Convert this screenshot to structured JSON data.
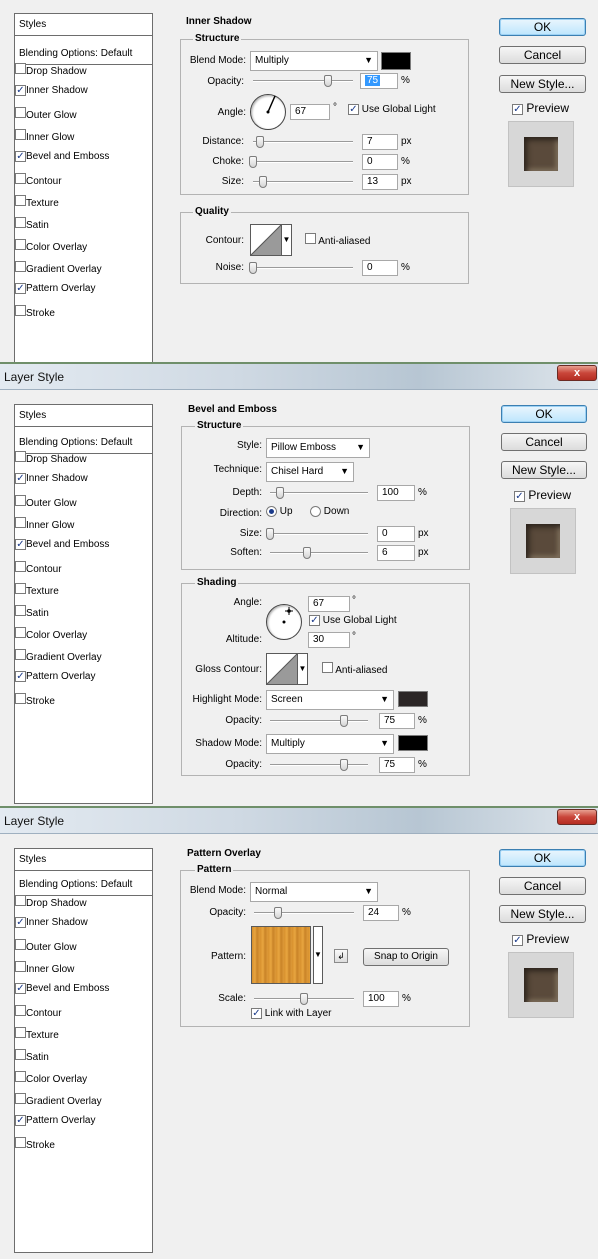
{
  "dialog_title": "Layer Style",
  "close_glyph": "x",
  "buttons": {
    "ok": "OK",
    "cancel": "Cancel",
    "new_style": "New Style...",
    "preview": "Preview"
  },
  "styles_list": {
    "header": "Styles",
    "blending": "Blending Options: Default",
    "items": [
      {
        "label": "Drop Shadow"
      },
      {
        "label": "Inner Shadow"
      },
      {
        "label": "Outer Glow"
      },
      {
        "label": "Inner Glow"
      },
      {
        "label": "Bevel and Emboss"
      },
      {
        "label": "Contour"
      },
      {
        "label": "Texture"
      },
      {
        "label": "Satin"
      },
      {
        "label": "Color Overlay"
      },
      {
        "label": "Gradient Overlay"
      },
      {
        "label": "Pattern Overlay"
      },
      {
        "label": "Stroke"
      }
    ],
    "checked": [
      false,
      true,
      false,
      false,
      true,
      false,
      false,
      false,
      false,
      false,
      true,
      false
    ]
  },
  "inner_shadow": {
    "title": "Inner Shadow",
    "structure": "Structure",
    "blend_mode_label": "Blend Mode:",
    "blend_mode": "Multiply",
    "color": "#000000",
    "opacity_label": "Opacity:",
    "opacity": "75",
    "opacity_unit": "%",
    "angle_label": "Angle:",
    "angle": "67",
    "angle_unit": "°",
    "use_global_light": "Use Global Light",
    "distance_label": "Distance:",
    "distance": "7",
    "distance_unit": "px",
    "choke_label": "Choke:",
    "choke": "0",
    "choke_unit": "%",
    "size_label": "Size:",
    "size": "13",
    "size_unit": "px",
    "quality": "Quality",
    "contour_label": "Contour:",
    "anti_aliased": "Anti-aliased",
    "noise_label": "Noise:",
    "noise": "0",
    "noise_unit": "%"
  },
  "bevel_emboss": {
    "title": "Bevel and Emboss",
    "structure": "Structure",
    "style_label": "Style:",
    "style": "Pillow Emboss",
    "technique_label": "Technique:",
    "technique": "Chisel Hard",
    "depth_label": "Depth:",
    "depth": "100",
    "depth_unit": "%",
    "direction_label": "Direction:",
    "up": "Up",
    "down": "Down",
    "size_label": "Size:",
    "size": "0",
    "size_unit": "px",
    "soften_label": "Soften:",
    "soften": "6",
    "soften_unit": "px",
    "shading": "Shading",
    "angle_label": "Angle:",
    "angle": "67",
    "angle_unit": "°",
    "use_global_light": "Use Global Light",
    "altitude_label": "Altitude:",
    "altitude": "30",
    "altitude_unit": "°",
    "gloss_contour_label": "Gloss Contour:",
    "anti_aliased": "Anti-aliased",
    "highlight_mode_label": "Highlight Mode:",
    "highlight_mode": "Screen",
    "highlight_color": "#2b2626",
    "opacity_label": "Opacity:",
    "highlight_opacity": "75",
    "opacity_unit": "%",
    "shadow_mode_label": "Shadow Mode:",
    "shadow_mode": "Multiply",
    "shadow_color": "#000000",
    "shadow_opacity": "75"
  },
  "pattern_overlay": {
    "title": "Pattern Overlay",
    "pattern_group": "Pattern",
    "blend_mode_label": "Blend Mode:",
    "blend_mode": "Normal",
    "opacity_label": "Opacity:",
    "opacity": "24",
    "opacity_unit": "%",
    "pattern_label": "Pattern:",
    "snap": "Snap to Origin",
    "scale_label": "Scale:",
    "scale": "100",
    "scale_unit": "%",
    "link_with_layer": "Link with Layer"
  },
  "slider_levels": {
    "is_opacity": 0.75,
    "is_distance": 0.07,
    "is_choke": 0.0,
    "is_size": 0.1,
    "is_noise": 0.0,
    "be_depth": 0.1,
    "be_size": 0.0,
    "be_soften": 0.38,
    "be_hl_opacity": 0.75,
    "be_sh_opacity": 0.75,
    "po_opacity": 0.24,
    "po_scale": 0.5
  },
  "colors": {
    "selection": "#3399ff",
    "dialog_bg": "#f0f0f0"
  }
}
